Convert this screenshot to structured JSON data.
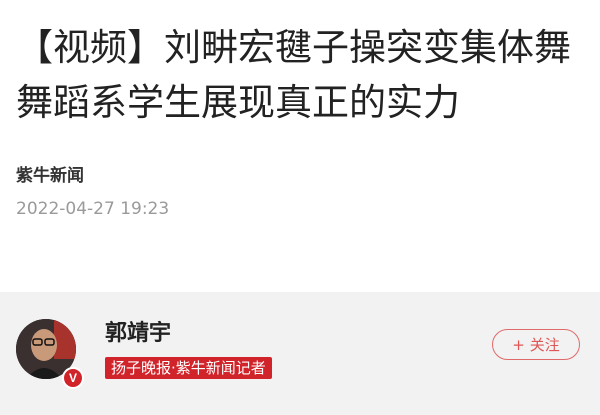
{
  "article": {
    "headline": "【视频】刘畊宏毽子操突变集体舞 舞蹈系学生展现真正的实力",
    "source": "紫牛新闻",
    "published": "2022-04-27 19:23"
  },
  "author": {
    "name": "郭靖宇",
    "title": "扬子晚报·紫牛新闻记者",
    "verified_mark": "V",
    "follow_plus": "+",
    "follow_label": "关注"
  },
  "colors": {
    "accent_red": "#d0232a",
    "follow_outline": "#e06a6a",
    "author_bar_bg": "#f2f2f2"
  }
}
